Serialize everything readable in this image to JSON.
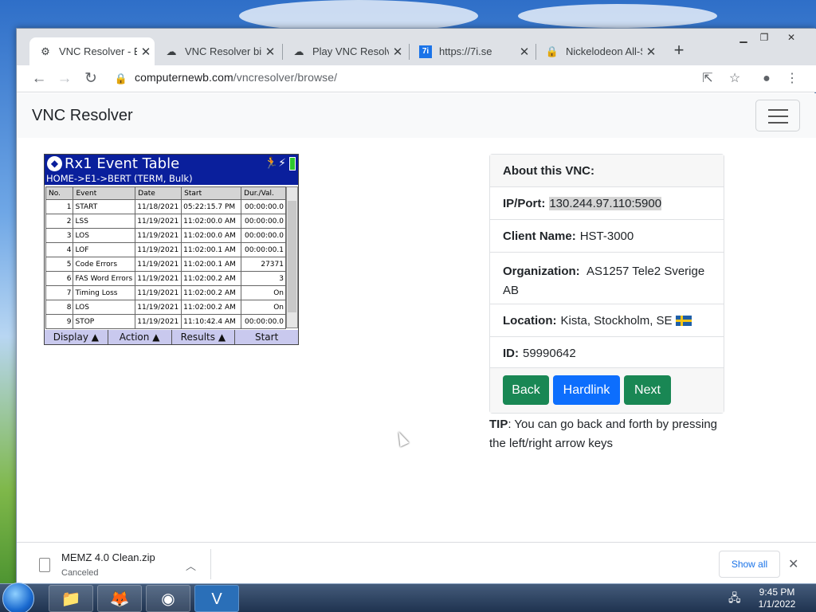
{
  "browser": {
    "tabs": [
      {
        "title": "VNC Resolver - Br",
        "icon": "vnc-resolver-icon",
        "active": true
      },
      {
        "title": "VNC Resolver bin",
        "icon": "puzzle-icon",
        "active": false
      },
      {
        "title": "Play VNC Resolve",
        "icon": "puzzle-icon",
        "active": false
      },
      {
        "title": "https://7i.se",
        "icon": "7i-icon",
        "active": false
      },
      {
        "title": "Nickelodeon All-S",
        "icon": "lock-icon",
        "active": false
      }
    ],
    "url_host": "computernewb.com",
    "url_path": "/vncresolver/browse/"
  },
  "navbar": {
    "brand": "VNC Resolver"
  },
  "device": {
    "title": "Rx1 Event Table",
    "breadcrumb": "HOME->E1->BERT (TERM, Bulk)",
    "columns": [
      "No.",
      "Event",
      "Date",
      "Start",
      "Dur./Val."
    ],
    "rows": [
      {
        "no": "1",
        "event": "START",
        "date": "11/18/2021",
        "start": "05:22:15.7 PM",
        "val": "00:00:00.0"
      },
      {
        "no": "2",
        "event": "LSS",
        "date": "11/19/2021",
        "start": "11:02:00.0 AM",
        "val": "00:00:00.0"
      },
      {
        "no": "3",
        "event": "LOS",
        "date": "11/19/2021",
        "start": "11:02:00.0 AM",
        "val": "00:00:00.0"
      },
      {
        "no": "4",
        "event": "LOF",
        "date": "11/19/2021",
        "start": "11:02:00.1 AM",
        "val": "00:00:00.1"
      },
      {
        "no": "5",
        "event": "Code Errors",
        "date": "11/19/2021",
        "start": "11:02:00.1 AM",
        "val": "27371"
      },
      {
        "no": "6",
        "event": "FAS Word Errors",
        "date": "11/19/2021",
        "start": "11:02:00.2 AM",
        "val": "3"
      },
      {
        "no": "7",
        "event": "Timing Loss",
        "date": "11/19/2021",
        "start": "11:02:00.2 AM",
        "val": "On"
      },
      {
        "no": "8",
        "event": "LOS",
        "date": "11/19/2021",
        "start": "11:02:00.2 AM",
        "val": "On"
      },
      {
        "no": "9",
        "event": "STOP",
        "date": "11/19/2021",
        "start": "11:10:42.4 AM",
        "val": "00:00:00.0"
      }
    ],
    "footer": [
      "Display",
      "Action",
      "Results",
      "Start"
    ]
  },
  "card": {
    "header": "About this VNC:",
    "ip_label": "IP/Port:",
    "ip_value": "130.244.97.110:5900",
    "client_label": "Client Name:",
    "client_value": "HST-3000",
    "org_label": "Organization:",
    "org_value": "AS1257 Tele2 Sverige AB",
    "loc_label": "Location:",
    "loc_value": "Kista, Stockholm, SE",
    "id_label": "ID:",
    "id_value": "59990642",
    "buttons": {
      "back": "Back",
      "hardlink": "Hardlink",
      "next": "Next"
    },
    "colors": {
      "green": "#198754",
      "blue": "#0d6efd"
    }
  },
  "tip": {
    "label": "TIP",
    "text": ": You can go back and forth by pressing the left/right arrow keys"
  },
  "download": {
    "file": "MEMZ 4.0 Clean.zip",
    "status": "Canceled",
    "show_all": "Show all"
  },
  "taskbar": {
    "time": "9:45 PM",
    "date": "1/1/2022"
  }
}
